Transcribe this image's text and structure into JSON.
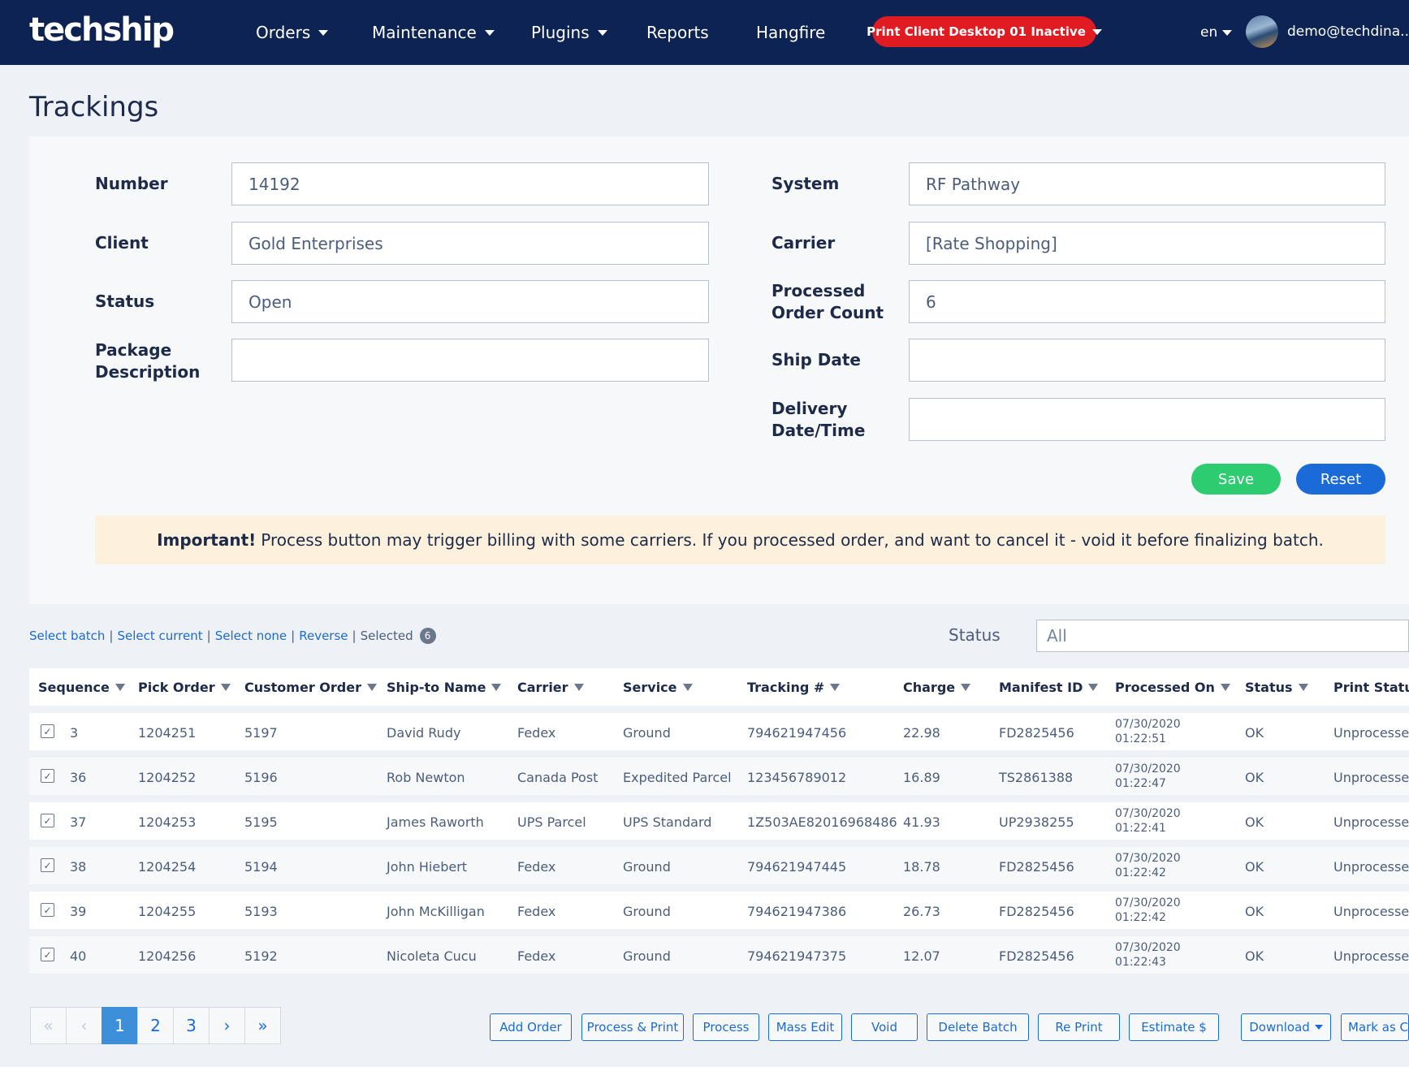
{
  "nav": {
    "logo": "techship",
    "items": [
      {
        "label": "Orders",
        "dropdown": true
      },
      {
        "label": "Maintenance",
        "dropdown": true
      },
      {
        "label": "Plugins",
        "dropdown": true
      },
      {
        "label": "Reports",
        "dropdown": false
      },
      {
        "label": "Hangfire",
        "dropdown": false
      }
    ],
    "print_client": "Print Client Desktop 01 Inactive",
    "lang": "en",
    "user": "demo@techdina..."
  },
  "page": {
    "title": "Trackings"
  },
  "form": {
    "number": {
      "label": "Number",
      "value": "14192"
    },
    "client": {
      "label": "Client",
      "value": "Gold Enterprises"
    },
    "status": {
      "label": "Status",
      "value": "Open"
    },
    "package_description": {
      "label_line1": "Package",
      "label_line2": "Description",
      "value": ""
    },
    "system": {
      "label": "System",
      "value": "RF Pathway"
    },
    "carrier": {
      "label": "Carrier",
      "value": "[Rate Shopping]"
    },
    "processed_order_count": {
      "label_line1": "Processed",
      "label_line2": "Order Count",
      "value": "6"
    },
    "ship_date": {
      "label": "Ship Date",
      "value": ""
    },
    "delivery": {
      "label_line1": "Delivery",
      "label_line2": "Date/Time",
      "value": ""
    },
    "save_label": "Save",
    "reset_label": "Reset"
  },
  "alert": {
    "strong": "Important!",
    "text": "Process button may trigger billing with some carriers. If you processed order, and want to cancel it - void it before finalizing batch."
  },
  "selection": {
    "select_batch": "Select batch",
    "select_current": "Select current",
    "select_none": "Select none",
    "reverse": "Reverse",
    "selected_label": "Selected",
    "selected_count": "6",
    "status_label": "Status",
    "status_value": "All"
  },
  "table": {
    "headers": [
      "Sequence",
      "Pick Order",
      "Customer Order",
      "Ship-to Name",
      "Carrier",
      "Service",
      "Tracking #",
      "Charge",
      "Manifest ID",
      "Processed On",
      "Status",
      "Print Status"
    ],
    "rows": [
      {
        "seq": "3",
        "pick": "1204251",
        "cust": "5197",
        "name": "David Rudy",
        "carrier": "Fedex",
        "service": "Ground",
        "tracking": "794621947456",
        "charge": "22.98",
        "manifest": "FD2825456",
        "date": "07/30/2020",
        "time": "01:22:51",
        "status": "OK",
        "print": "Unprocessed"
      },
      {
        "seq": "36",
        "pick": "1204252",
        "cust": "5196",
        "name": "Rob Newton",
        "carrier": "Canada Post",
        "service": "Expedited Parcel",
        "tracking": "123456789012",
        "charge": "16.89",
        "manifest": "TS2861388",
        "date": "07/30/2020",
        "time": "01:22:47",
        "status": "OK",
        "print": "Unprocessed"
      },
      {
        "seq": "37",
        "pick": "1204253",
        "cust": "5195",
        "name": "James Raworth",
        "carrier": "UPS Parcel",
        "service": "UPS Standard",
        "tracking": "1Z503AE82016968486",
        "charge": "41.93",
        "manifest": "UP2938255",
        "date": "07/30/2020",
        "time": "01:22:41",
        "status": "OK",
        "print": "Unprocessed"
      },
      {
        "seq": "38",
        "pick": "1204254",
        "cust": "5194",
        "name": "John Hiebert",
        "carrier": "Fedex",
        "service": "Ground",
        "tracking": "794621947445",
        "charge": "18.78",
        "manifest": "FD2825456",
        "date": "07/30/2020",
        "time": "01:22:42",
        "status": "OK",
        "print": "Unprocessed"
      },
      {
        "seq": "39",
        "pick": "1204255",
        "cust": "5193",
        "name": "John McKilligan",
        "carrier": "Fedex",
        "service": "Ground",
        "tracking": "794621947386",
        "charge": "26.73",
        "manifest": "FD2825456",
        "date": "07/30/2020",
        "time": "01:22:42",
        "status": "OK",
        "print": "Unprocessed"
      },
      {
        "seq": "40",
        "pick": "1204256",
        "cust": "5192",
        "name": "Nicoleta Cucu",
        "carrier": "Fedex",
        "service": "Ground",
        "tracking": "794621947375",
        "charge": "12.07",
        "manifest": "FD2825456",
        "date": "07/30/2020",
        "time": "01:22:43",
        "status": "OK",
        "print": "Unprocessed"
      }
    ]
  },
  "pagination": {
    "first": "«",
    "prev": "‹",
    "pages": [
      "1",
      "2",
      "3"
    ],
    "active": "1",
    "next": "›",
    "last": "»"
  },
  "actions": [
    "Add Order",
    "Process & Print",
    "Process",
    "Mass Edit",
    "Void",
    "Delete Batch",
    "Re Print",
    "Estimate $",
    "Download",
    "Mark as Closed"
  ],
  "colors": {
    "navbar": "#0d2354",
    "print_client": "#e11b22",
    "save": "#2ecc71",
    "reset": "#1a6bd8",
    "alert_bg": "#fdf1dd",
    "link": "#1a6bd8"
  }
}
